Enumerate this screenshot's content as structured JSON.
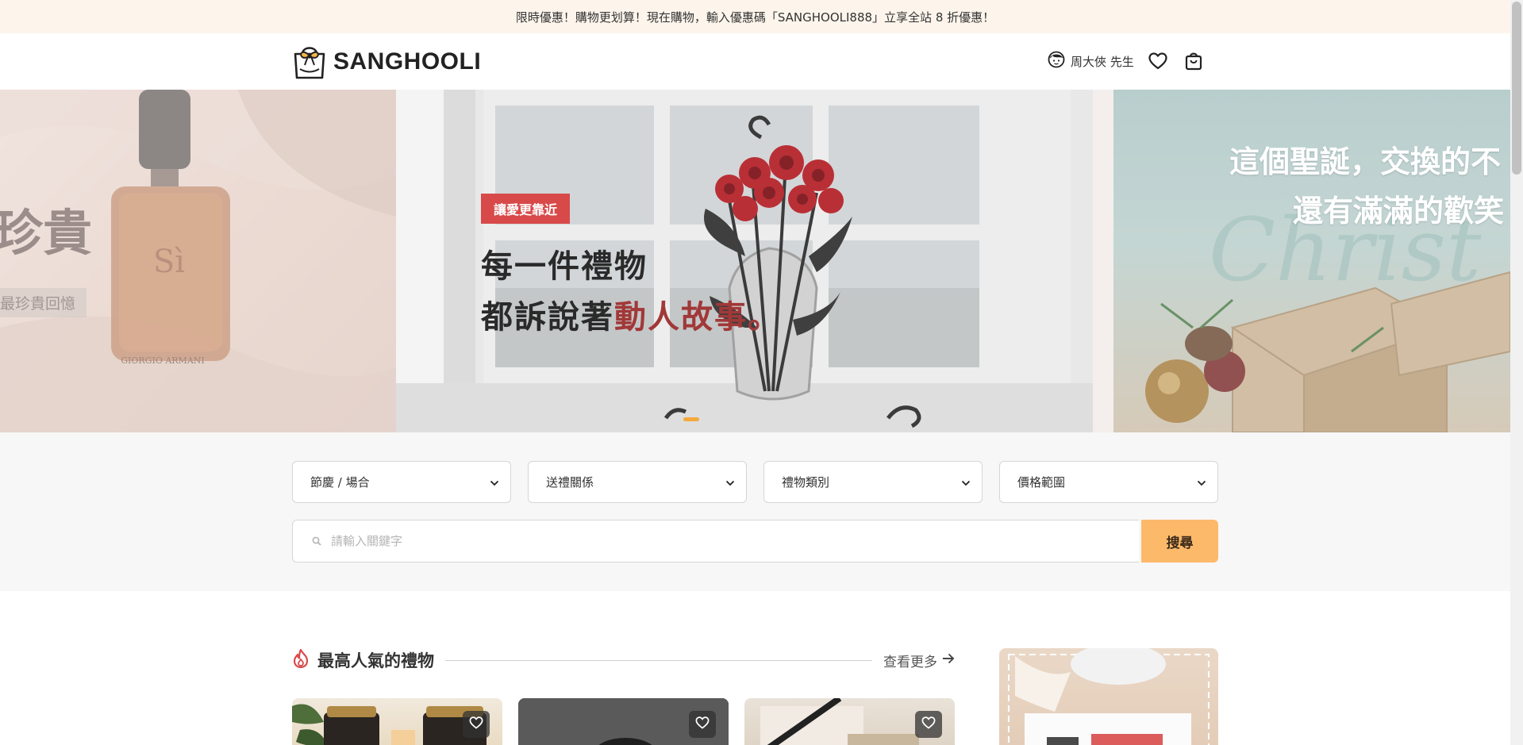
{
  "promo": {
    "text": "限時優惠！購物更划算！現在購物，輸入優惠碼「SANGHOOLI888」立享全站 8 折優惠！"
  },
  "header": {
    "logo_text": "SANGHOOLI",
    "user_name": "周大俠 先生",
    "icons": [
      "user-avatar-icon",
      "heart-icon",
      "shopping-bag-icon"
    ]
  },
  "hero": {
    "active_slide": {
      "tag": "讓愛更靠近",
      "line1": "每一件禮物",
      "line2_dark": "都訴說著",
      "line2_accent": "動人故事。"
    },
    "prev_slide": {
      "big_text": "珍貴",
      "small_text": "最珍貴回憶"
    },
    "next_slide": {
      "line1": "這個聖誕，交換的不",
      "line2": "還有滿滿的歡笑"
    }
  },
  "filters": [
    {
      "label": "節慶 / 場合"
    },
    {
      "label": "送禮關係"
    },
    {
      "label": "禮物類別"
    },
    {
      "label": "價格範圍"
    }
  ],
  "search": {
    "placeholder": "請輸入關鍵字",
    "button_label": "搜尋"
  },
  "popular": {
    "title": "最高人氣的禮物",
    "more_label": "查看更多"
  },
  "colors": {
    "accent": "#fdb96a",
    "tag_red": "#d84a4a",
    "story_red": "#a13838",
    "promo_bg": "#fdf5ec"
  }
}
